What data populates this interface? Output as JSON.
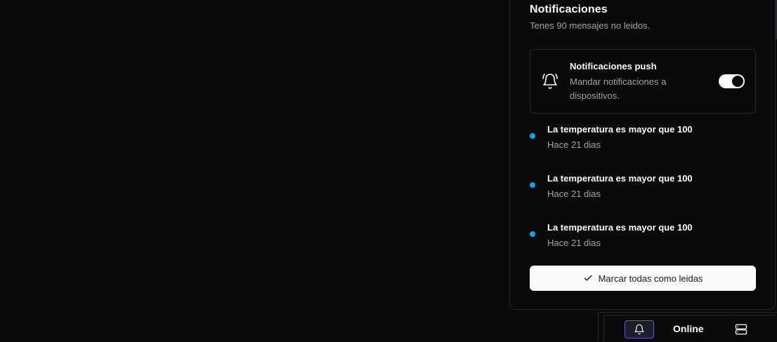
{
  "notifications_panel": {
    "title": "Notificaciones",
    "subtitle": "Tenes 90 mensajes no leidos.",
    "push": {
      "title": "Notificaciones push",
      "description": "Mandar notificaciones a dispositivos.",
      "enabled": true,
      "icon": "bell-ring-icon"
    },
    "items": [
      {
        "title": "La temperatura es mayor que 100",
        "time": "Hace 21 dias"
      },
      {
        "title": "La temperatura es mayor que 100",
        "time": "Hace 21 dias"
      },
      {
        "title": "La temperatura es mayor que 100",
        "time": "Hace 21 dias"
      }
    ],
    "mark_all_label": "Marcar todas como leidas",
    "mark_all_icon": "check-icon"
  },
  "statusbar": {
    "bell_icon": "bell-icon",
    "status_label": "Online",
    "server_icon": "server-icon"
  },
  "colors": {
    "background": "#0a0a0b",
    "border": "#26262b",
    "unread_dot": "#0ea5e9",
    "muted_text": "#a1a1aa",
    "active_button_border": "#5b5bd6"
  }
}
